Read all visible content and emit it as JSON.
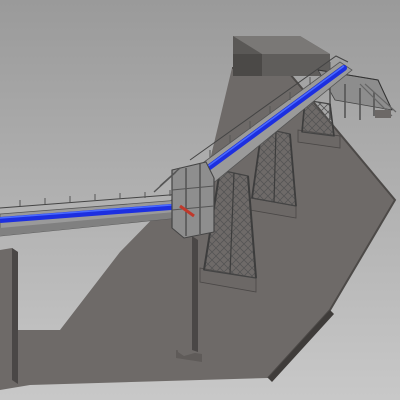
{
  "scene": {
    "background_top": "#9a9a9a",
    "background_bottom": "#c8c8c8",
    "ground_color": "#6e6a68",
    "ground_edge_color": "#4d4a48",
    "structure_color": "#9a9a9a",
    "structure_dark": "#6a6a6a",
    "belt_color": "#1d2fe0",
    "belt_highlight": "#4a6cff",
    "footing_color": "#6c6866",
    "transfer_accent": "#c0392b"
  }
}
